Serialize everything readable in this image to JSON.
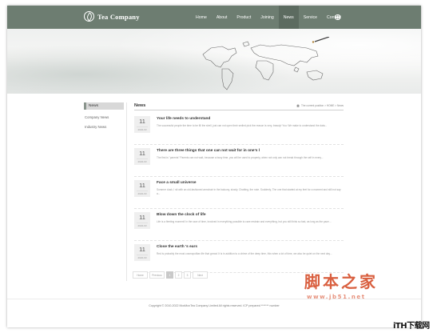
{
  "header": {
    "logo_text": "Tea Company",
    "nav": [
      "Home",
      "About",
      "Product",
      "Joining",
      "News",
      "Service",
      "Contact"
    ],
    "active_nav": "News"
  },
  "sidebar": {
    "title": "News",
    "items": [
      "Company News",
      "Industry News"
    ]
  },
  "content": {
    "title": "News",
    "breadcrumb": "The current position > HOME > News"
  },
  "news": [
    {
      "day": "11",
      "ym": "2022-03",
      "title": "Your life needs to understand",
      "desc": "The successful people the time to be fill the shell, just can not open their smiled pick the reason is very, beauty! You: We make to understand the data..."
    },
    {
      "day": "11",
      "ym": "2022-03",
      "title": "There are three things that one can not wait for in one's l",
      "desc": "The first is \"parents\" Parents can not wait, because a busy time, you will be used to property, when not only can not break through the self in every..."
    },
    {
      "day": "11",
      "ym": "2022-03",
      "title": "Face a small universe",
      "desc": "Summer dusk, I sit with an old-fashioned armchair in the balcony, slowly. Chatting, the note. Suddenly, The one that started at my feet for a moment and still not say a..."
    },
    {
      "day": "11",
      "ym": "2022-03",
      "title": "Blow down the clock of life",
      "desc": "Life is a fleeting moment! In the race of time, involved in everything possible to care restrain and everything, but you still think so fast, as long as the pace..."
    },
    {
      "day": "11",
      "ym": "2022-03",
      "title": "Close the earth 's ears",
      "desc": "Red is probably the most cosmopolitan life that grows! It is in addition to a chime of the deep time, this when a lot of time, we also be quiet on the next day..."
    }
  ],
  "pager": {
    "first": "Home",
    "prev": "Previous",
    "pages": [
      "1",
      "2",
      "3"
    ],
    "current": "1",
    "next": "Next"
  },
  "footer": {
    "copyright": "Copyright © 2010-2022 MoxMoxTea Company Limited All rights reserved. ICP prepared ******* number"
  },
  "watermark": {
    "cn": "脚本之家",
    "url": "www.jb51.net",
    "corner": "iTH下载网"
  },
  "colors": {
    "header_bg": "#6d7d71",
    "accent_red": "#d95f3f"
  }
}
